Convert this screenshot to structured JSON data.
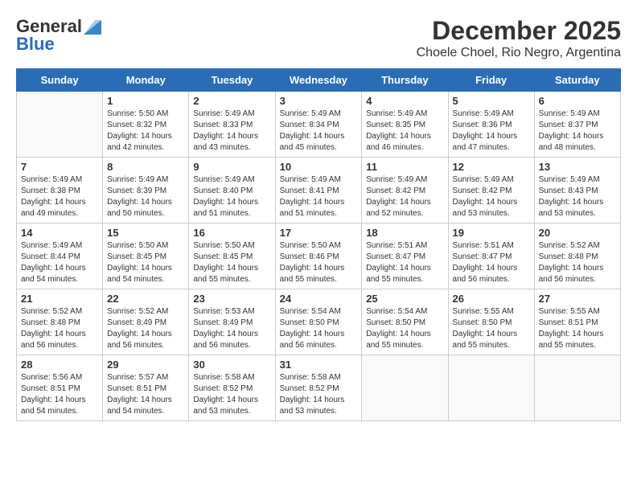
{
  "logo": {
    "general": "General",
    "blue": "Blue"
  },
  "title": "December 2025",
  "subtitle": "Choele Choel, Rio Negro, Argentina",
  "weekdays": [
    "Sunday",
    "Monday",
    "Tuesday",
    "Wednesday",
    "Thursday",
    "Friday",
    "Saturday"
  ],
  "weeks": [
    [
      {
        "day": "",
        "sunrise": "",
        "sunset": "",
        "daylight": ""
      },
      {
        "day": "1",
        "sunrise": "Sunrise: 5:50 AM",
        "sunset": "Sunset: 8:32 PM",
        "daylight": "Daylight: 14 hours and 42 minutes."
      },
      {
        "day": "2",
        "sunrise": "Sunrise: 5:49 AM",
        "sunset": "Sunset: 8:33 PM",
        "daylight": "Daylight: 14 hours and 43 minutes."
      },
      {
        "day": "3",
        "sunrise": "Sunrise: 5:49 AM",
        "sunset": "Sunset: 8:34 PM",
        "daylight": "Daylight: 14 hours and 45 minutes."
      },
      {
        "day": "4",
        "sunrise": "Sunrise: 5:49 AM",
        "sunset": "Sunset: 8:35 PM",
        "daylight": "Daylight: 14 hours and 46 minutes."
      },
      {
        "day": "5",
        "sunrise": "Sunrise: 5:49 AM",
        "sunset": "Sunset: 8:36 PM",
        "daylight": "Daylight: 14 hours and 47 minutes."
      },
      {
        "day": "6",
        "sunrise": "Sunrise: 5:49 AM",
        "sunset": "Sunset: 8:37 PM",
        "daylight": "Daylight: 14 hours and 48 minutes."
      }
    ],
    [
      {
        "day": "7",
        "sunrise": "Sunrise: 5:49 AM",
        "sunset": "Sunset: 8:38 PM",
        "daylight": "Daylight: 14 hours and 49 minutes."
      },
      {
        "day": "8",
        "sunrise": "Sunrise: 5:49 AM",
        "sunset": "Sunset: 8:39 PM",
        "daylight": "Daylight: 14 hours and 50 minutes."
      },
      {
        "day": "9",
        "sunrise": "Sunrise: 5:49 AM",
        "sunset": "Sunset: 8:40 PM",
        "daylight": "Daylight: 14 hours and 51 minutes."
      },
      {
        "day": "10",
        "sunrise": "Sunrise: 5:49 AM",
        "sunset": "Sunset: 8:41 PM",
        "daylight": "Daylight: 14 hours and 51 minutes."
      },
      {
        "day": "11",
        "sunrise": "Sunrise: 5:49 AM",
        "sunset": "Sunset: 8:42 PM",
        "daylight": "Daylight: 14 hours and 52 minutes."
      },
      {
        "day": "12",
        "sunrise": "Sunrise: 5:49 AM",
        "sunset": "Sunset: 8:42 PM",
        "daylight": "Daylight: 14 hours and 53 minutes."
      },
      {
        "day": "13",
        "sunrise": "Sunrise: 5:49 AM",
        "sunset": "Sunset: 8:43 PM",
        "daylight": "Daylight: 14 hours and 53 minutes."
      }
    ],
    [
      {
        "day": "14",
        "sunrise": "Sunrise: 5:49 AM",
        "sunset": "Sunset: 8:44 PM",
        "daylight": "Daylight: 14 hours and 54 minutes."
      },
      {
        "day": "15",
        "sunrise": "Sunrise: 5:50 AM",
        "sunset": "Sunset: 8:45 PM",
        "daylight": "Daylight: 14 hours and 54 minutes."
      },
      {
        "day": "16",
        "sunrise": "Sunrise: 5:50 AM",
        "sunset": "Sunset: 8:45 PM",
        "daylight": "Daylight: 14 hours and 55 minutes."
      },
      {
        "day": "17",
        "sunrise": "Sunrise: 5:50 AM",
        "sunset": "Sunset: 8:46 PM",
        "daylight": "Daylight: 14 hours and 55 minutes."
      },
      {
        "day": "18",
        "sunrise": "Sunrise: 5:51 AM",
        "sunset": "Sunset: 8:47 PM",
        "daylight": "Daylight: 14 hours and 55 minutes."
      },
      {
        "day": "19",
        "sunrise": "Sunrise: 5:51 AM",
        "sunset": "Sunset: 8:47 PM",
        "daylight": "Daylight: 14 hours and 56 minutes."
      },
      {
        "day": "20",
        "sunrise": "Sunrise: 5:52 AM",
        "sunset": "Sunset: 8:48 PM",
        "daylight": "Daylight: 14 hours and 56 minutes."
      }
    ],
    [
      {
        "day": "21",
        "sunrise": "Sunrise: 5:52 AM",
        "sunset": "Sunset: 8:48 PM",
        "daylight": "Daylight: 14 hours and 56 minutes."
      },
      {
        "day": "22",
        "sunrise": "Sunrise: 5:52 AM",
        "sunset": "Sunset: 8:49 PM",
        "daylight": "Daylight: 14 hours and 56 minutes."
      },
      {
        "day": "23",
        "sunrise": "Sunrise: 5:53 AM",
        "sunset": "Sunset: 8:49 PM",
        "daylight": "Daylight: 14 hours and 56 minutes."
      },
      {
        "day": "24",
        "sunrise": "Sunrise: 5:54 AM",
        "sunset": "Sunset: 8:50 PM",
        "daylight": "Daylight: 14 hours and 56 minutes."
      },
      {
        "day": "25",
        "sunrise": "Sunrise: 5:54 AM",
        "sunset": "Sunset: 8:50 PM",
        "daylight": "Daylight: 14 hours and 55 minutes."
      },
      {
        "day": "26",
        "sunrise": "Sunrise: 5:55 AM",
        "sunset": "Sunset: 8:50 PM",
        "daylight": "Daylight: 14 hours and 55 minutes."
      },
      {
        "day": "27",
        "sunrise": "Sunrise: 5:55 AM",
        "sunset": "Sunset: 8:51 PM",
        "daylight": "Daylight: 14 hours and 55 minutes."
      }
    ],
    [
      {
        "day": "28",
        "sunrise": "Sunrise: 5:56 AM",
        "sunset": "Sunset: 8:51 PM",
        "daylight": "Daylight: 14 hours and 54 minutes."
      },
      {
        "day": "29",
        "sunrise": "Sunrise: 5:57 AM",
        "sunset": "Sunset: 8:51 PM",
        "daylight": "Daylight: 14 hours and 54 minutes."
      },
      {
        "day": "30",
        "sunrise": "Sunrise: 5:58 AM",
        "sunset": "Sunset: 8:52 PM",
        "daylight": "Daylight: 14 hours and 53 minutes."
      },
      {
        "day": "31",
        "sunrise": "Sunrise: 5:58 AM",
        "sunset": "Sunset: 8:52 PM",
        "daylight": "Daylight: 14 hours and 53 minutes."
      },
      {
        "day": "",
        "sunrise": "",
        "sunset": "",
        "daylight": ""
      },
      {
        "day": "",
        "sunrise": "",
        "sunset": "",
        "daylight": ""
      },
      {
        "day": "",
        "sunrise": "",
        "sunset": "",
        "daylight": ""
      }
    ]
  ]
}
